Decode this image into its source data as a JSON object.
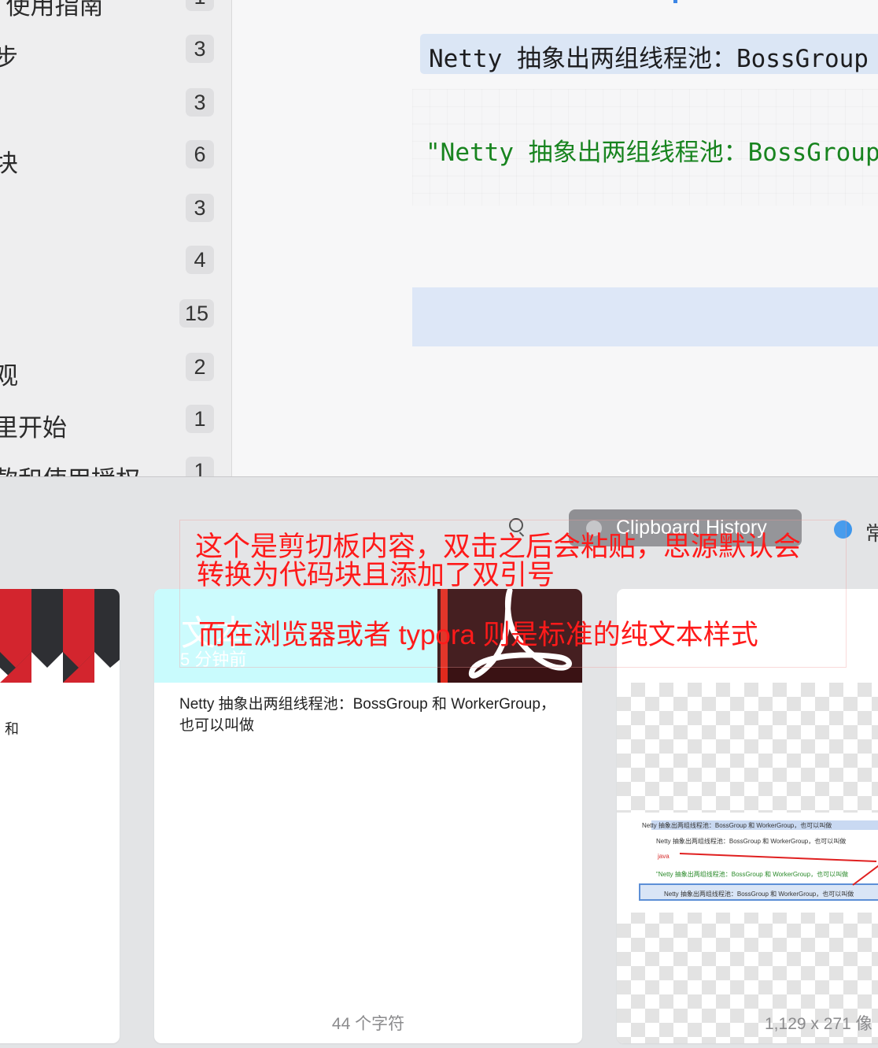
{
  "sidebar": {
    "items": [
      {
        "label": "i 使用指南",
        "count": "1"
      },
      {
        "label": "步",
        "count": "3"
      },
      {
        "label": "",
        "count": "3"
      },
      {
        "label": "块",
        "count": "6"
      },
      {
        "label": "",
        "count": "3"
      },
      {
        "label": "",
        "count": "4"
      },
      {
        "label": "",
        "count": "15"
      },
      {
        "label": "观",
        "count": "2"
      },
      {
        "label": "里开始",
        "count": "1"
      },
      {
        "label": "款和使用授权",
        "count": "1"
      }
    ]
  },
  "editor": {
    "heading_text": "Netty 抽象出两组线程池：BossGroup",
    "code_text": "\"Netty 抽象出两组线程池：BossGroup"
  },
  "clipboard": {
    "history_label": "Clipboard History",
    "category_label": "常",
    "cards": [
      {
        "text": "和"
      },
      {
        "title": "文本",
        "time": "5 分钟前",
        "text": "Netty 抽象出两组线程池：BossGroup 和 WorkerGroup，也可以叫做",
        "footer": "44 个字符"
      },
      {
        "footer": "1,129 x 271 像"
      }
    ],
    "thumbnail_rows": [
      "Netty 抽象出两组线程池：BossGroup 和 WorkerGroup，也可以叫做",
      "Netty 抽象出两组线程池：BossGroup 和 WorkerGroup，也可以叫做",
      "java",
      "\"Netty 抽象出两组线程池：BossGroup 和 WorkerGroup，也可以叫做",
      "Netty 抽象出两组线程池：BossGroup 和 WorkerGroup，也可以叫做"
    ]
  },
  "annotation": {
    "line1": "这个是剪切板内容，双击之后会粘贴，思源默认会",
    "line2": "转换为代码块且添加了双引号",
    "line3": "而在浏览器或者 typora 则是标准的纯文本样式",
    "color": "#ff1a1a"
  }
}
